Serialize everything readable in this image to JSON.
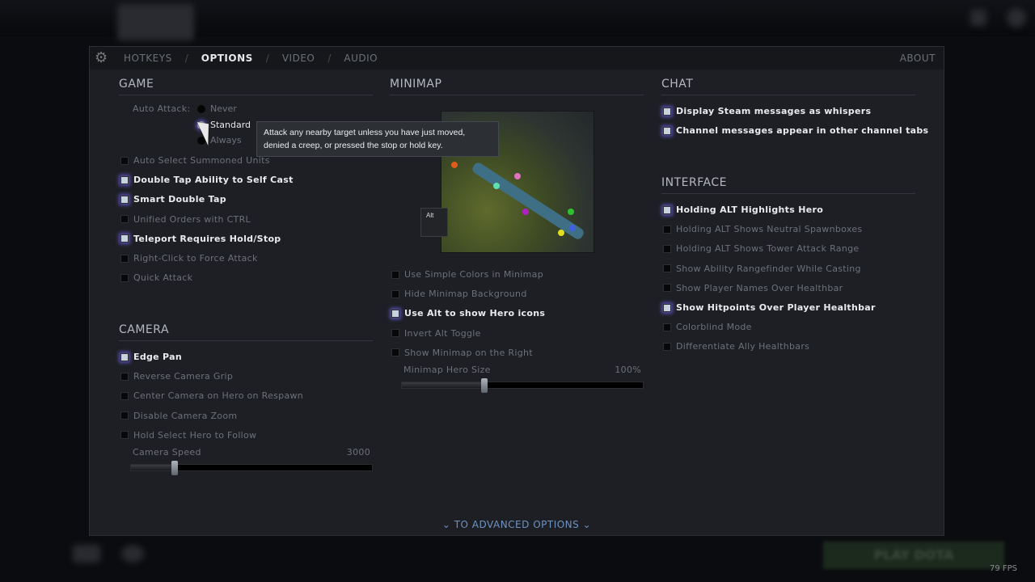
{
  "header": {
    "tabs": [
      {
        "label": "HOTKEYS"
      },
      {
        "label": "OPTIONS"
      },
      {
        "label": "VIDEO"
      },
      {
        "label": "AUDIO"
      }
    ],
    "separator": "/",
    "about": "ABOUT",
    "active_tab": "OPTIONS"
  },
  "game": {
    "title": "GAME",
    "auto_attack_label": "Auto Attack:",
    "auto_attack_options": [
      "Never",
      "Standard",
      "Always"
    ],
    "auto_attack_selected": "Standard",
    "items": [
      {
        "label": "Auto Select Summoned Units",
        "checked": false
      },
      {
        "label": "Double Tap Ability to Self Cast",
        "checked": true
      },
      {
        "label": "Smart Double Tap",
        "checked": true
      },
      {
        "label": "Unified Orders with CTRL",
        "checked": false
      },
      {
        "label": "Teleport Requires Hold/Stop",
        "checked": true
      },
      {
        "label": "Right-Click to Force Attack",
        "checked": false
      },
      {
        "label": "Quick Attack",
        "checked": false
      }
    ]
  },
  "tooltip": "Attack any nearby target unless you have just moved, denied a creep, or pressed the stop or hold key.",
  "camera": {
    "title": "CAMERA",
    "items": [
      {
        "label": "Edge Pan",
        "checked": true
      },
      {
        "label": "Reverse Camera Grip",
        "checked": false
      },
      {
        "label": "Center Camera on Hero on Respawn",
        "checked": false
      },
      {
        "label": "Disable Camera Zoom",
        "checked": false
      },
      {
        "label": "Hold Select Hero to Follow",
        "checked": false
      }
    ],
    "speed_label": "Camera Speed",
    "speed_value": "3000",
    "speed_fraction": 0.18
  },
  "minimap": {
    "title": "MINIMAP",
    "alt_key": "Alt",
    "items": [
      {
        "label": "Use Simple Colors in Minimap",
        "checked": false
      },
      {
        "label": "Hide Minimap Background",
        "checked": false
      },
      {
        "label": "Use Alt to show Hero icons",
        "checked": true
      },
      {
        "label": "Invert Alt Toggle",
        "checked": false
      },
      {
        "label": "Show Minimap on the Right",
        "checked": false
      }
    ],
    "hero_size_label": "Minimap Hero Size",
    "hero_size_value": "100%",
    "hero_size_fraction": 0.34
  },
  "chat": {
    "title": "CHAT",
    "items": [
      {
        "label": "Display Steam messages as whispers",
        "checked": true
      },
      {
        "label": "Channel messages appear in other channel tabs",
        "checked": true
      }
    ]
  },
  "interface": {
    "title": "INTERFACE",
    "items": [
      {
        "label": "Holding ALT Highlights Hero",
        "checked": true
      },
      {
        "label": "Holding ALT Shows Neutral Spawnboxes",
        "checked": false
      },
      {
        "label": "Holding ALT Shows Tower Attack Range",
        "checked": false
      },
      {
        "label": "Show Ability Rangefinder While Casting",
        "checked": false
      },
      {
        "label": "Show Player Names Over Healthbar",
        "checked": false
      },
      {
        "label": "Show Hitpoints Over Player Healthbar",
        "checked": true
      },
      {
        "label": "Colorblind Mode",
        "checked": false
      },
      {
        "label": "Differentiate Ally Healthbars",
        "checked": false
      }
    ]
  },
  "advanced": "TO ADVANCED OPTIONS",
  "play_button": "PLAY DOTA",
  "fps": "79 FPS"
}
